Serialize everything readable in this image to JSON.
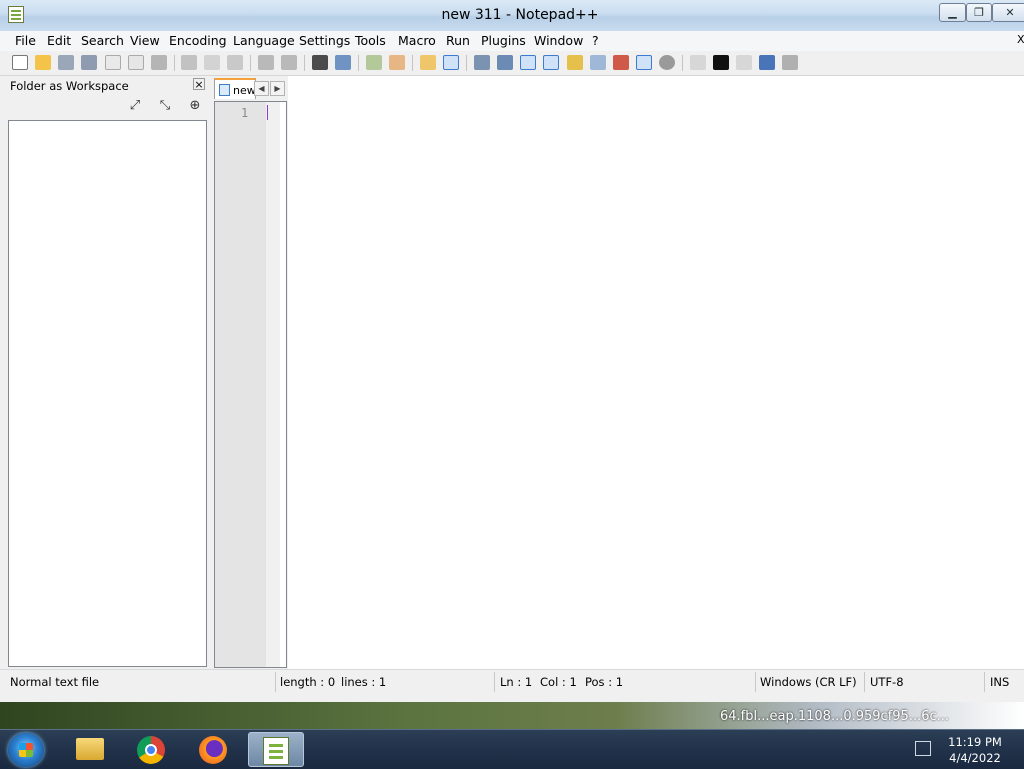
{
  "window": {
    "title": "new 311 - Notepad++",
    "controls": {
      "minimize": "▁",
      "maximize": "❐",
      "close": "✕"
    }
  },
  "menu": [
    "File",
    "Edit",
    "Search",
    "View",
    "Encoding",
    "Language",
    "Settings",
    "Tools",
    "Macro",
    "Run",
    "Plugins",
    "Window",
    "?"
  ],
  "menu_close": "X",
  "toolbar": {
    "icons": [
      "new-file",
      "open-file",
      "save",
      "save-all",
      "close",
      "close-all",
      "print",
      "cut",
      "copy",
      "paste",
      "undo",
      "redo",
      "find",
      "replace",
      "zoom-in",
      "zoom-out",
      "sync-vertical",
      "sync-horizontal",
      "word-wrap",
      "show-all-characters",
      "indent-guide",
      "user-defined-language",
      "document-map",
      "function-list",
      "folder-as-workspace",
      "monitoring",
      "record-macro",
      "stop-recording",
      "playback-macro",
      "run-macro-multiple",
      "save-macro"
    ]
  },
  "panel": {
    "title": "Folder as Workspace",
    "close": "×",
    "buttons": [
      "expand-all",
      "collapse-all",
      "locate-current-file"
    ]
  },
  "tabs": [
    {
      "label": "new"
    }
  ],
  "tab_nav": {
    "left": "◀",
    "right": "▶"
  },
  "editor": {
    "line_numbers": [
      "1"
    ],
    "content": ""
  },
  "status": {
    "file_type": "Normal text file",
    "length": "length : 0",
    "lines": "lines : 1",
    "ln": "Ln : 1",
    "col": "Col : 1",
    "pos": "Pos : 1",
    "eol": "Windows (CR LF)",
    "encoding": "UTF-8",
    "mode": "INS"
  },
  "desktop": {
    "partial_text": "64.fbl...eap.1108...0.959cf95...6c..."
  },
  "taskbar": {
    "apps": [
      "file-explorer",
      "chrome",
      "firefox",
      "notepad-plus-plus"
    ],
    "time": "11:19 PM",
    "date": "4/4/2022"
  }
}
